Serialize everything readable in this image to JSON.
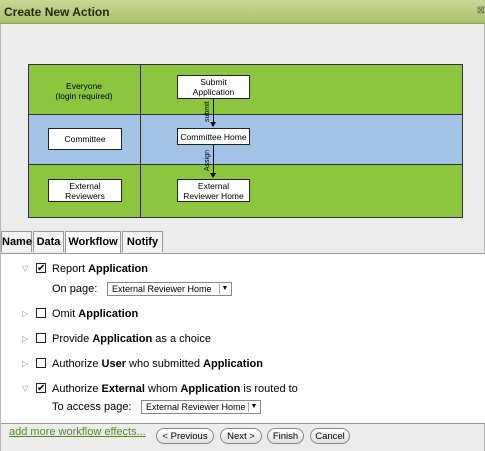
{
  "window": {
    "title": "Create New Action",
    "close_glyph": "⊠"
  },
  "diagram": {
    "lanes": [
      {
        "role_label": "Everyone\n(login required)",
        "page": "Submit\nApplication"
      },
      {
        "role_label": "Committee",
        "page": "Committee Home"
      },
      {
        "role_label": "External\nReviewers",
        "page": "External\nReviewer Home"
      }
    ],
    "arrows": [
      "submit",
      "Assign"
    ]
  },
  "tabs": [
    "Name",
    "Data",
    "Workflow",
    "Notify"
  ],
  "active_tab": "Workflow",
  "effects": [
    {
      "expanded": true,
      "checked": true,
      "prefix": "Report ",
      "bold1": "Application",
      "mid": "",
      "bold2": "",
      "suffix": "",
      "sub_label": "On page:",
      "sub_value": "External Reviewer Home"
    },
    {
      "expanded": false,
      "checked": false,
      "prefix": "Omit ",
      "bold1": "Application",
      "mid": "",
      "bold2": "",
      "suffix": ""
    },
    {
      "expanded": false,
      "checked": false,
      "prefix": "Provide ",
      "bold1": "Application",
      "mid": " as a choice",
      "bold2": "",
      "suffix": ""
    },
    {
      "expanded": false,
      "checked": false,
      "prefix": "Authorize ",
      "bold1": "User",
      "mid": " who submitted ",
      "bold2": "Application",
      "suffix": ""
    },
    {
      "expanded": true,
      "checked": true,
      "prefix": "Authorize ",
      "bold1": "External",
      "mid": " whom ",
      "bold2": "Application",
      "suffix": " is routed to",
      "sub_label": "To access page:",
      "sub_value": "External Reviewer Home"
    }
  ],
  "add_more_link": "add more workflow effects...",
  "buttons": {
    "previous": "< Previous",
    "next": "Next >",
    "finish": "Finish",
    "cancel": "Cancel"
  },
  "colors": {
    "title_bar": "#a9bf6a",
    "lane_green": "#8cc63e",
    "lane_blue": "#a2c2e6",
    "link": "#4e8e1a"
  }
}
